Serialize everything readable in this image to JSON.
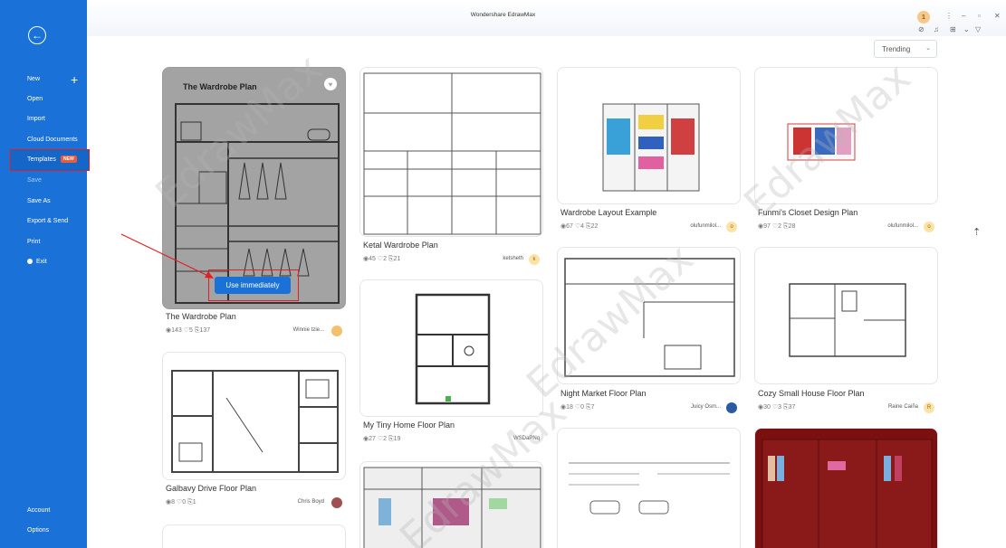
{
  "app": {
    "title": "Wondershare EdrawMax",
    "user_initial": "1"
  },
  "sidebar": {
    "back_icon": "back-arrow-icon",
    "items": [
      {
        "label": "New"
      },
      {
        "label": "Open"
      },
      {
        "label": "Import"
      },
      {
        "label": "Cloud Documents"
      },
      {
        "label": "Templates",
        "badge": "NEW"
      },
      {
        "label": "Save"
      },
      {
        "label": "Save As"
      },
      {
        "label": "Export & Send"
      },
      {
        "label": "Print"
      },
      {
        "label": "Exit"
      },
      {
        "label": "Account"
      },
      {
        "label": "Options"
      }
    ]
  },
  "toolbar": {
    "sort_label": "Trending",
    "sort_chevron": "⌄"
  },
  "watermark": "EdrawMax",
  "cards": [
    {
      "title": "The Wardrobe Plan",
      "views": "143",
      "likes": "5",
      "copies": "137",
      "author": "Winnie tzie...",
      "image_title": "The Wardrobe Plan",
      "action": "Use immediately"
    },
    {
      "title": "Galbavy Drive Floor Plan",
      "views": "8",
      "likes": "0",
      "copies": "1",
      "author": "Chris Boyd"
    },
    {
      "title": "Ketal Wardrobe Plan",
      "views": "45",
      "likes": "2",
      "copies": "21",
      "author": "ketsheth",
      "author_initial": "k"
    },
    {
      "title": "My Tiny Home Floor Plan",
      "views": "27",
      "likes": "2",
      "copies": "19",
      "author": "WSDaPNq"
    },
    {
      "title": "Wardrobe Layout Example",
      "views": "67",
      "likes": "4",
      "copies": "22",
      "author": "olufunmilol...",
      "author_initial": "o"
    },
    {
      "title": "Night Market Floor Plan",
      "views": "18",
      "likes": "0",
      "copies": "7",
      "author": "Juicy Osm..."
    },
    {
      "title": "Funmi's Closet Design Plan",
      "views": "97",
      "likes": "2",
      "copies": "28",
      "author": "olufunmilol...",
      "author_initial": "o"
    },
    {
      "title": "Cozy Small House Floor Plan",
      "views": "30",
      "likes": "3",
      "copies": "37",
      "author": "Raine Caiña",
      "author_initial": "R"
    }
  ],
  "icons": {
    "views": "eye-icon",
    "likes": "heart-icon",
    "copies": "copy-icon"
  }
}
